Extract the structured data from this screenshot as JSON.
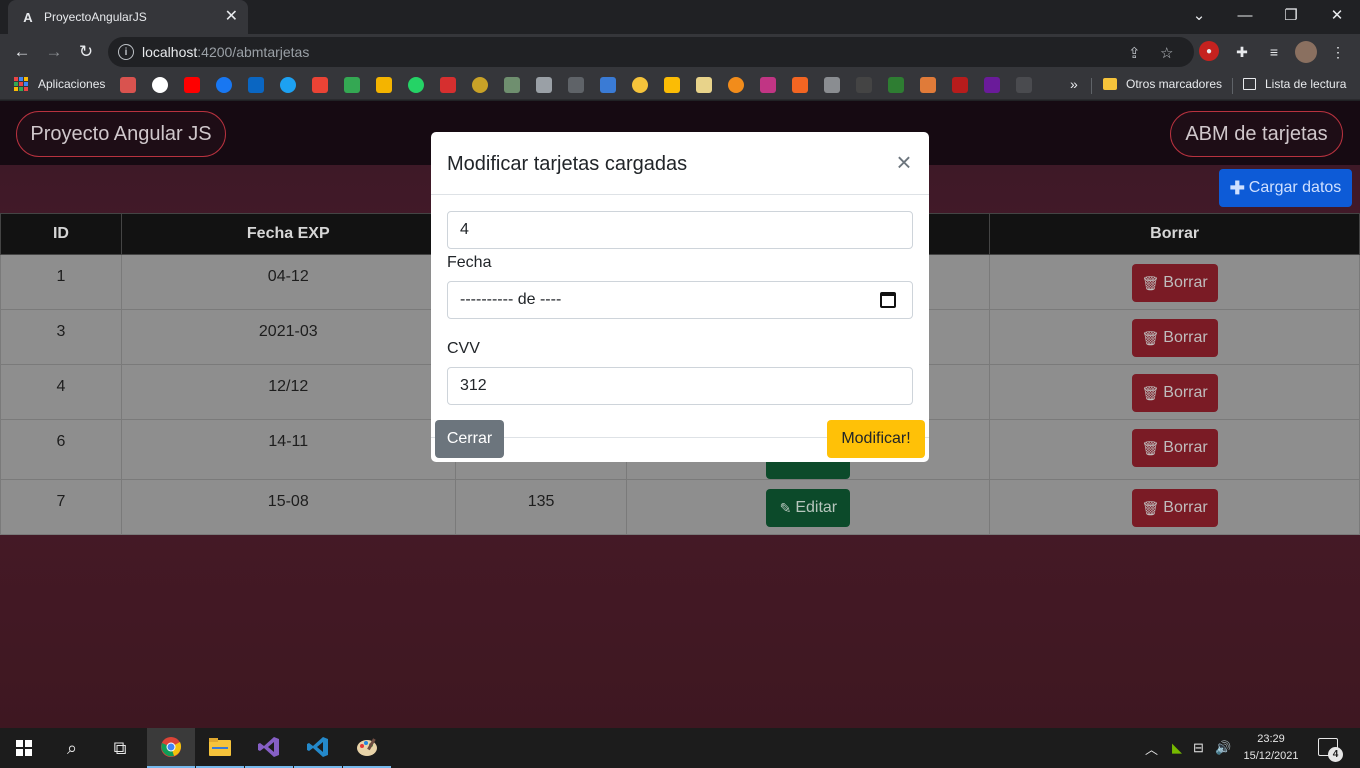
{
  "browser": {
    "tab_title": "ProyectoAngularJS",
    "tab_close": "✕",
    "url_host": "localhost",
    "url_path": ":4200/abmtarjetas",
    "bookmarks": {
      "apps_label": "Aplicaciones",
      "more_label": "»",
      "folder_label": "Otros marcadores",
      "reading_label": "Lista de lectura"
    }
  },
  "navbar": {
    "brand_label": "Proyecto Angular JS",
    "abm_label": "ABM de tarjetas"
  },
  "actions": {
    "cargar_label": "Cargar datos"
  },
  "table": {
    "headers": [
      "ID",
      "Fecha EXP",
      "",
      "",
      "Borrar"
    ],
    "edit_label": "Editar",
    "delete_label": "Borrar",
    "rows": [
      {
        "id": "1",
        "fecha": "04-12",
        "cvv": ""
      },
      {
        "id": "3",
        "fecha": "2021-03",
        "cvv": ""
      },
      {
        "id": "4",
        "fecha": "12/12",
        "cvv": ""
      },
      {
        "id": "6",
        "fecha": "14-11",
        "cvv": ""
      },
      {
        "id": "7",
        "fecha": "15-08",
        "cvv": "135"
      }
    ]
  },
  "modal": {
    "title": "Modificar tarjetas cargadas",
    "close": "×",
    "id_value": "4",
    "fecha_label": "Fecha",
    "fecha_value": "---------- de ----",
    "cvv_label": "CVV",
    "cvv_value": "312",
    "cerrar_label": "Cerrar",
    "modificar_label": "Modificar!"
  },
  "taskbar": {
    "time": "23:29",
    "date": "15/12/2021",
    "notifications": "4"
  }
}
